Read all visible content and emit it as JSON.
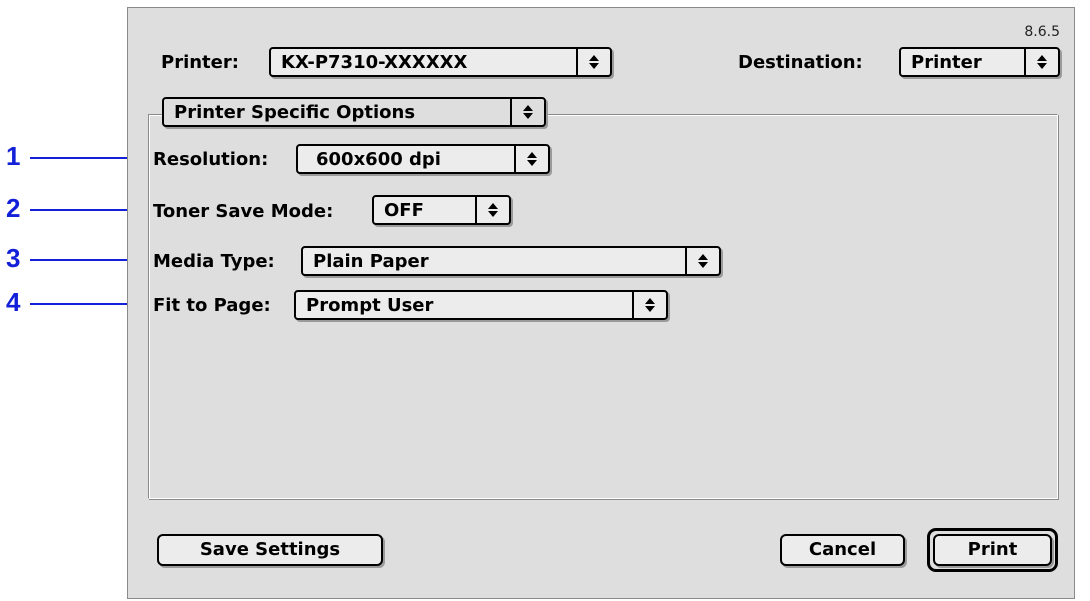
{
  "dialog": {
    "version": "8.6.5",
    "printer_label": "Printer:",
    "printer_value": "KX-P7310-XXXXXX",
    "destination_label": "Destination:",
    "destination_value": "Printer",
    "panel_value": "Printer Specific Options",
    "options": {
      "resolution_label": "Resolution:",
      "resolution_value": "600x600 dpi",
      "toner_label": "Toner Save Mode:",
      "toner_value": "OFF",
      "media_label": "Media Type:",
      "media_value": "Plain Paper",
      "fit_label": "Fit to Page:",
      "fit_value": "Prompt User"
    },
    "buttons": {
      "save_settings": "Save Settings",
      "cancel": "Cancel",
      "print": "Print"
    }
  },
  "callouts": [
    "1",
    "2",
    "3",
    "4"
  ],
  "colors": {
    "callout": "#1220d8",
    "dialog_bg": "#dedede"
  }
}
